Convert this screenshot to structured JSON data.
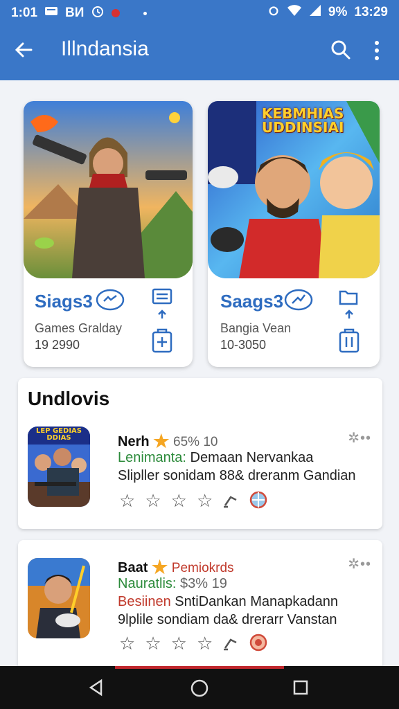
{
  "status_bar": {
    "time_left": "1:01",
    "carrier": "BИ",
    "battery": "9%",
    "time_right": "13:29"
  },
  "app_bar": {
    "title": "Illndansia"
  },
  "featured": [
    {
      "title": "Siags3",
      "subtitle": "Games Gralday",
      "count": "19 2990"
    },
    {
      "banner": "KEBMHIAS UDDINSIAI",
      "title": "Saags3",
      "subtitle": "Bangia Vean",
      "count": "10-3050"
    }
  ],
  "section": {
    "title": "Undlovis"
  },
  "items": [
    {
      "thumb_label": "LEP GEDIAS DDIAS",
      "name": "Nerh",
      "meta": "65% 10",
      "line1_prefix": "Lenimanta:",
      "line1_rest": " Demaan Nervankaa",
      "line2": "Slipller sonidam 88& dreranm Gandian"
    },
    {
      "name": "Baat",
      "meta": "Pemiokrds",
      "line1_prefix": "Nauratlis:",
      "line1_rest": " $3% 19",
      "line2_prefix": "Besiinen",
      "line2_rest": " SntiDankan Manapkadann",
      "line3": "9lplile sondiam da& drerarr Vanstan"
    }
  ],
  "colors": {
    "app_bar": "#3a77c8",
    "accent_blue": "#2e6cc0",
    "green": "#2b8a3a",
    "red": "#c0392b",
    "star": "#f5a623"
  }
}
